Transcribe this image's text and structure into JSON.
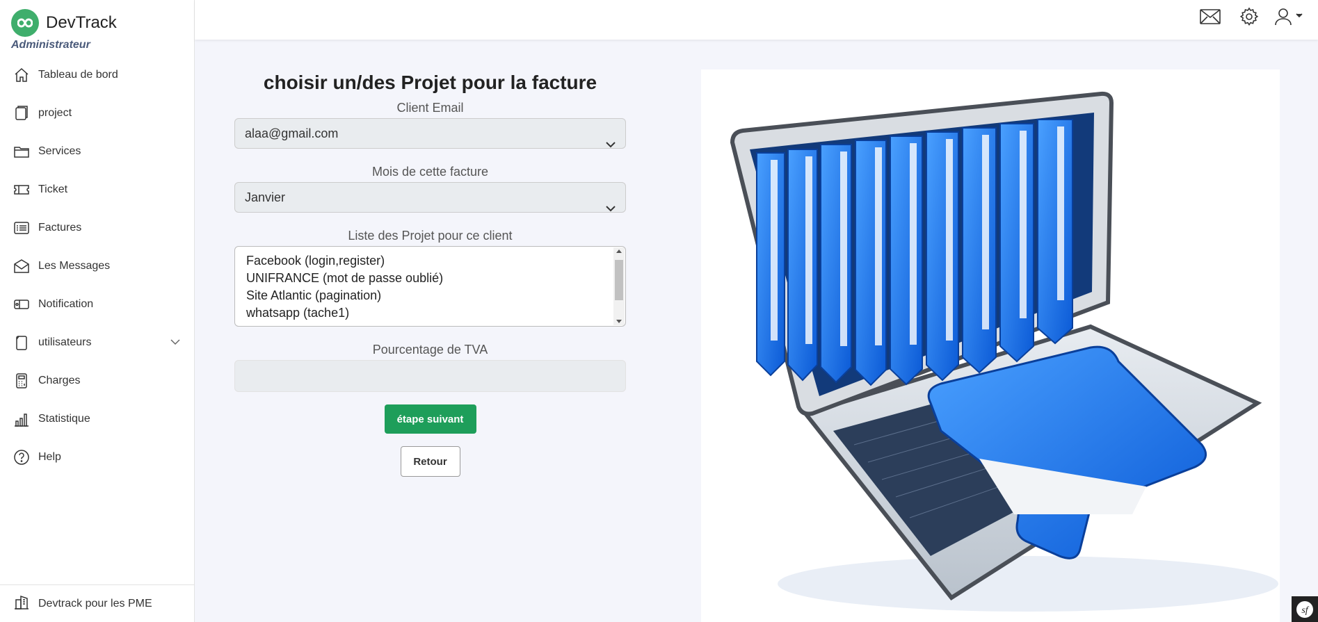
{
  "brand": {
    "name": "DevTrack",
    "role": "Administrateur"
  },
  "sidebar": {
    "items": [
      {
        "label": "Tableau de bord",
        "icon": "home-icon"
      },
      {
        "label": "project",
        "icon": "document-icon"
      },
      {
        "label": "Services",
        "icon": "folder-icon"
      },
      {
        "label": "Ticket",
        "icon": "ticket-icon"
      },
      {
        "label": "Factures",
        "icon": "list-icon"
      },
      {
        "label": "Les Messages",
        "icon": "envelope-icon"
      },
      {
        "label": "Notification",
        "icon": "notification-icon"
      },
      {
        "label": "utilisateurs",
        "icon": "phone-icon"
      },
      {
        "label": "Charges",
        "icon": "calculator-icon"
      },
      {
        "label": "Statistique",
        "icon": "bar-chart-icon"
      },
      {
        "label": "Help",
        "icon": "question-icon"
      }
    ],
    "footer_label": "Devtrack pour les PME"
  },
  "header": {
    "icons": [
      "mail-icon",
      "gear-icon",
      "user-icon"
    ]
  },
  "form": {
    "title": "choisir un/des Projet pour la facture",
    "client_email_label": "Client Email",
    "client_email_value": "alaa@gmail.com",
    "month_label": "Mois de cette facture",
    "month_value": "Janvier",
    "projects_label": "Liste des Projet pour ce client",
    "projects": [
      "Facebook (login,register)",
      "UNIFRANCE (mot de passe oublié)",
      "Site Atlantic (pagination)",
      "whatsapp (tache1)"
    ],
    "tva_label": "Pourcentage de TVA",
    "tva_value": "",
    "next_button": "étape suivant",
    "back_button": "Retour"
  },
  "colors": {
    "brand": "#3fae6c",
    "primary_button": "#1e9e5a",
    "folder_blue": "#1f6fe0"
  }
}
